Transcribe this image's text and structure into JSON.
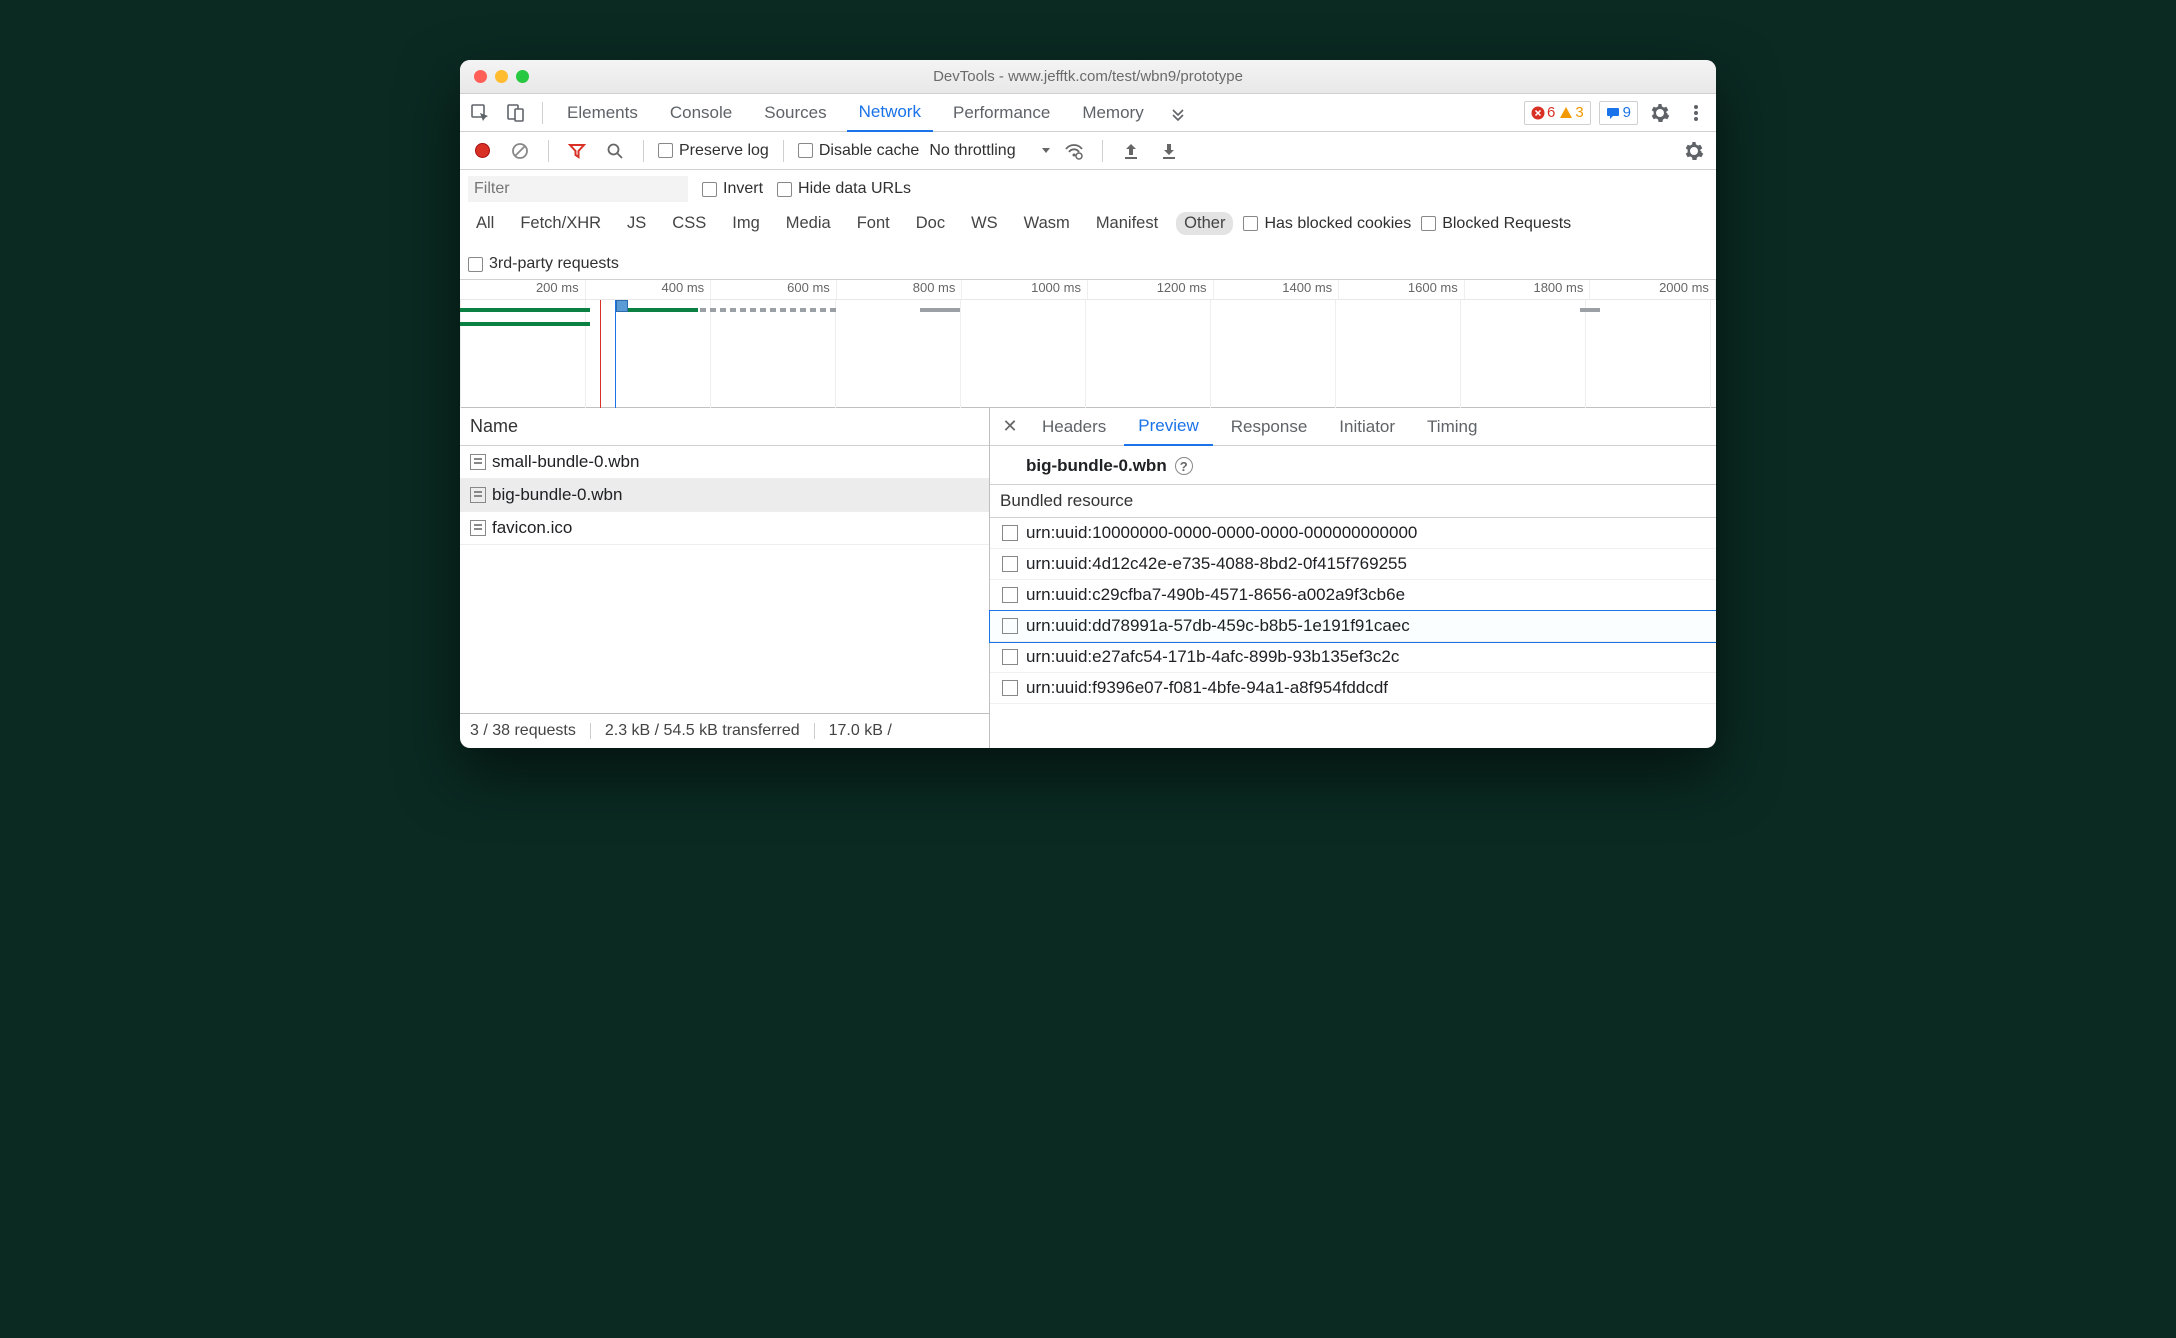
{
  "window": {
    "title": "DevTools - www.jefftk.com/test/wbn9/prototype"
  },
  "mainTabs": {
    "items": [
      "Elements",
      "Console",
      "Sources",
      "Network",
      "Performance",
      "Memory"
    ],
    "active": "Network",
    "errors": "6",
    "warnings": "3",
    "messages": "9"
  },
  "toolbar": {
    "preserveLog": "Preserve log",
    "disableCache": "Disable cache",
    "throttling": "No throttling"
  },
  "filter": {
    "placeholder": "Filter",
    "invert": "Invert",
    "hideDataUrls": "Hide data URLs"
  },
  "typeFilters": {
    "items": [
      "All",
      "Fetch/XHR",
      "JS",
      "CSS",
      "Img",
      "Media",
      "Font",
      "Doc",
      "WS",
      "Wasm",
      "Manifest",
      "Other"
    ],
    "selected": "Other",
    "hasBlockedCookies": "Has blocked cookies",
    "blockedRequests": "Blocked Requests",
    "thirdParty": "3rd-party requests"
  },
  "overview": {
    "ticks": [
      "200 ms",
      "400 ms",
      "600 ms",
      "800 ms",
      "1000 ms",
      "1200 ms",
      "1400 ms",
      "1600 ms",
      "1800 ms",
      "2000 ms"
    ]
  },
  "requests": {
    "header": "Name",
    "items": [
      {
        "name": "small-bundle-0.wbn",
        "selected": false
      },
      {
        "name": "big-bundle-0.wbn",
        "selected": true
      },
      {
        "name": "favicon.ico",
        "selected": false
      }
    ]
  },
  "detailTabs": {
    "items": [
      "Headers",
      "Preview",
      "Response",
      "Initiator",
      "Timing"
    ],
    "active": "Preview"
  },
  "preview": {
    "title": "big-bundle-0.wbn",
    "sectionTitle": "Bundled resource",
    "resources": [
      "urn:uuid:10000000-0000-0000-0000-000000000000",
      "urn:uuid:4d12c42e-e735-4088-8bd2-0f415f769255",
      "urn:uuid:c29cfba7-490b-4571-8656-a002a9f3cb6e",
      "urn:uuid:dd78991a-57db-459c-b8b5-1e191f91caec",
      "urn:uuid:e27afc54-171b-4afc-899b-93b135ef3c2c",
      "urn:uuid:f9396e07-f081-4bfe-94a1-a8f954fddcdf"
    ],
    "selectedIndex": 3
  },
  "status": {
    "requests": "3 / 38 requests",
    "transferred": "2.3 kB / 54.5 kB transferred",
    "resources": "17.0 kB /"
  }
}
